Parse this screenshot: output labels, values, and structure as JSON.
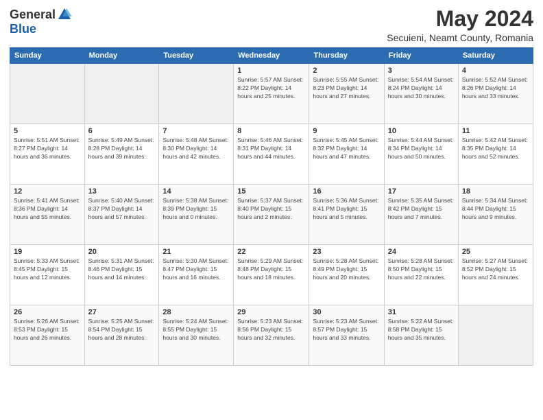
{
  "header": {
    "logo_general": "General",
    "logo_blue": "Blue",
    "main_title": "May 2024",
    "subtitle": "Secuieni, Neamt County, Romania"
  },
  "days_of_week": [
    "Sunday",
    "Monday",
    "Tuesday",
    "Wednesday",
    "Thursday",
    "Friday",
    "Saturday"
  ],
  "weeks": [
    [
      {
        "day": "",
        "detail": ""
      },
      {
        "day": "",
        "detail": ""
      },
      {
        "day": "",
        "detail": ""
      },
      {
        "day": "1",
        "detail": "Sunrise: 5:57 AM\nSunset: 8:22 PM\nDaylight: 14 hours\nand 25 minutes."
      },
      {
        "day": "2",
        "detail": "Sunrise: 5:55 AM\nSunset: 8:23 PM\nDaylight: 14 hours\nand 27 minutes."
      },
      {
        "day": "3",
        "detail": "Sunrise: 5:54 AM\nSunset: 8:24 PM\nDaylight: 14 hours\nand 30 minutes."
      },
      {
        "day": "4",
        "detail": "Sunrise: 5:52 AM\nSunset: 8:26 PM\nDaylight: 14 hours\nand 33 minutes."
      }
    ],
    [
      {
        "day": "5",
        "detail": "Sunrise: 5:51 AM\nSunset: 8:27 PM\nDaylight: 14 hours\nand 36 minutes."
      },
      {
        "day": "6",
        "detail": "Sunrise: 5:49 AM\nSunset: 8:28 PM\nDaylight: 14 hours\nand 39 minutes."
      },
      {
        "day": "7",
        "detail": "Sunrise: 5:48 AM\nSunset: 8:30 PM\nDaylight: 14 hours\nand 42 minutes."
      },
      {
        "day": "8",
        "detail": "Sunrise: 5:46 AM\nSunset: 8:31 PM\nDaylight: 14 hours\nand 44 minutes."
      },
      {
        "day": "9",
        "detail": "Sunrise: 5:45 AM\nSunset: 8:32 PM\nDaylight: 14 hours\nand 47 minutes."
      },
      {
        "day": "10",
        "detail": "Sunrise: 5:44 AM\nSunset: 8:34 PM\nDaylight: 14 hours\nand 50 minutes."
      },
      {
        "day": "11",
        "detail": "Sunrise: 5:42 AM\nSunset: 8:35 PM\nDaylight: 14 hours\nand 52 minutes."
      }
    ],
    [
      {
        "day": "12",
        "detail": "Sunrise: 5:41 AM\nSunset: 8:36 PM\nDaylight: 14 hours\nand 55 minutes."
      },
      {
        "day": "13",
        "detail": "Sunrise: 5:40 AM\nSunset: 8:37 PM\nDaylight: 14 hours\nand 57 minutes."
      },
      {
        "day": "14",
        "detail": "Sunrise: 5:38 AM\nSunset: 8:39 PM\nDaylight: 15 hours\nand 0 minutes."
      },
      {
        "day": "15",
        "detail": "Sunrise: 5:37 AM\nSunset: 8:40 PM\nDaylight: 15 hours\nand 2 minutes."
      },
      {
        "day": "16",
        "detail": "Sunrise: 5:36 AM\nSunset: 8:41 PM\nDaylight: 15 hours\nand 5 minutes."
      },
      {
        "day": "17",
        "detail": "Sunrise: 5:35 AM\nSunset: 8:42 PM\nDaylight: 15 hours\nand 7 minutes."
      },
      {
        "day": "18",
        "detail": "Sunrise: 5:34 AM\nSunset: 8:44 PM\nDaylight: 15 hours\nand 9 minutes."
      }
    ],
    [
      {
        "day": "19",
        "detail": "Sunrise: 5:33 AM\nSunset: 8:45 PM\nDaylight: 15 hours\nand 12 minutes."
      },
      {
        "day": "20",
        "detail": "Sunrise: 5:31 AM\nSunset: 8:46 PM\nDaylight: 15 hours\nand 14 minutes."
      },
      {
        "day": "21",
        "detail": "Sunrise: 5:30 AM\nSunset: 8:47 PM\nDaylight: 15 hours\nand 16 minutes."
      },
      {
        "day": "22",
        "detail": "Sunrise: 5:29 AM\nSunset: 8:48 PM\nDaylight: 15 hours\nand 18 minutes."
      },
      {
        "day": "23",
        "detail": "Sunrise: 5:28 AM\nSunset: 8:49 PM\nDaylight: 15 hours\nand 20 minutes."
      },
      {
        "day": "24",
        "detail": "Sunrise: 5:28 AM\nSunset: 8:50 PM\nDaylight: 15 hours\nand 22 minutes."
      },
      {
        "day": "25",
        "detail": "Sunrise: 5:27 AM\nSunset: 8:52 PM\nDaylight: 15 hours\nand 24 minutes."
      }
    ],
    [
      {
        "day": "26",
        "detail": "Sunrise: 5:26 AM\nSunset: 8:53 PM\nDaylight: 15 hours\nand 26 minutes."
      },
      {
        "day": "27",
        "detail": "Sunrise: 5:25 AM\nSunset: 8:54 PM\nDaylight: 15 hours\nand 28 minutes."
      },
      {
        "day": "28",
        "detail": "Sunrise: 5:24 AM\nSunset: 8:55 PM\nDaylight: 15 hours\nand 30 minutes."
      },
      {
        "day": "29",
        "detail": "Sunrise: 5:23 AM\nSunset: 8:56 PM\nDaylight: 15 hours\nand 32 minutes."
      },
      {
        "day": "30",
        "detail": "Sunrise: 5:23 AM\nSunset: 8:57 PM\nDaylight: 15 hours\nand 33 minutes."
      },
      {
        "day": "31",
        "detail": "Sunrise: 5:22 AM\nSunset: 8:58 PM\nDaylight: 15 hours\nand 35 minutes."
      },
      {
        "day": "",
        "detail": ""
      }
    ]
  ]
}
